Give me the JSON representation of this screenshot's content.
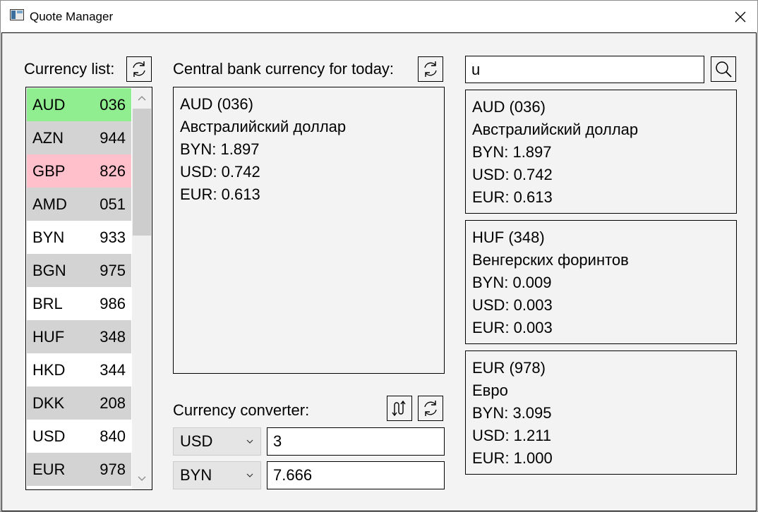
{
  "window": {
    "title": "Quote Manager"
  },
  "currency_list": {
    "label": "Currency list:",
    "items": [
      {
        "code": "AUD",
        "num": "036",
        "bg": "#90ee90"
      },
      {
        "code": "AZN",
        "num": "944",
        "bg": "#d3d3d3"
      },
      {
        "code": "GBP",
        "num": "826",
        "bg": "#ffc0cb"
      },
      {
        "code": "AMD",
        "num": "051",
        "bg": "#d3d3d3"
      },
      {
        "code": "BYN",
        "num": "933",
        "bg": "#ffffff"
      },
      {
        "code": "BGN",
        "num": "975",
        "bg": "#d3d3d3"
      },
      {
        "code": "BRL",
        "num": "986",
        "bg": "#ffffff"
      },
      {
        "code": "HUF",
        "num": "348",
        "bg": "#d3d3d3"
      },
      {
        "code": "HKD",
        "num": "344",
        "bg": "#ffffff"
      },
      {
        "code": "DKK",
        "num": "208",
        "bg": "#d3d3d3"
      },
      {
        "code": "USD",
        "num": "840",
        "bg": "#ffffff"
      },
      {
        "code": "EUR",
        "num": "978",
        "bg": "#d3d3d3"
      }
    ]
  },
  "central_bank": {
    "label": "Central bank currency for today:",
    "lines": [
      "AUD (036)",
      "Австралийский доллар",
      "BYN: 1.897",
      "USD: 0.742",
      "EUR: 0.613"
    ]
  },
  "converter": {
    "label": "Currency converter:",
    "from_currency": "USD",
    "from_amount": "3",
    "to_currency": "BYN",
    "to_amount": "7.666"
  },
  "search": {
    "value": "u",
    "results": [
      {
        "lines": [
          "AUD (036)",
          "Австралийский доллар",
          "BYN: 1.897",
          "USD: 0.742",
          "EUR: 0.613"
        ]
      },
      {
        "lines": [
          "HUF (348)",
          "Венгерских форинтов",
          "BYN: 0.009",
          "USD: 0.003",
          "EUR: 0.003"
        ]
      },
      {
        "lines": [
          "EUR (978)",
          "Евро",
          "BYN: 3.095",
          "USD: 1.211",
          "EUR: 1.000"
        ]
      }
    ]
  },
  "icons": {
    "refresh": "refresh-icon",
    "swap": "swap-icon",
    "search": "search-icon",
    "close": "close-icon"
  }
}
